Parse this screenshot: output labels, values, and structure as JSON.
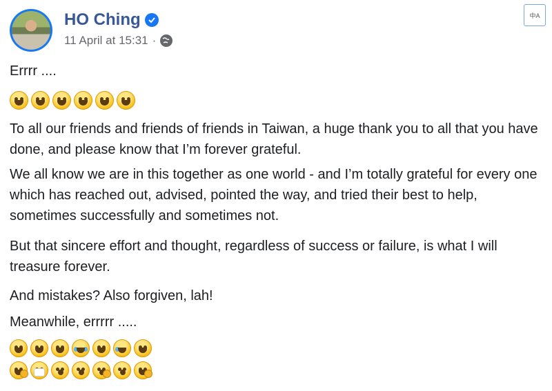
{
  "header": {
    "name": "HO Ching",
    "verified": true,
    "timestamp": "11 April at 15:31",
    "separator": "·",
    "privacy_icon": "globe-icon"
  },
  "translate_button": {
    "icon": "translate-icon",
    "text": "中A"
  },
  "post": {
    "line1": "Errrr ....",
    "emoji_row1": [
      "grinning-sweat",
      "grinning-sweat",
      "grinning",
      "grinning",
      "grinning-sweat",
      "grinning-sweat"
    ],
    "para1": "To all our friends and friends of friends in Taiwan, a huge thank you to all that you have done, and please know that I’m forever grateful.",
    "para2": "We all know we are in this together as one world - and I’m totally grateful for every one which has reached out, advised, pointed the way, and tried their best to help, sometimes successfully and sometimes not.",
    "para3": "But that sincere effort and thought, regardless of success or failure, is what I will treasure forever.",
    "para4": "And mistakes? Also forgiven, lah!",
    "para5": "Meanwhile, errrrr .....",
    "emoji_row2": [
      "smiling-halo",
      "upside-down",
      "smirk",
      "tears-of-joy",
      "zany",
      "rolling-laughing",
      "smiling-halo"
    ],
    "emoji_row3": [
      "face-with-hand",
      "mask",
      "open-mouth",
      "screaming",
      "thinking",
      "flushed",
      "face-with-hand"
    ]
  },
  "colors": {
    "name": "#385898",
    "verified": "#1877f2",
    "meta": "#65676b",
    "text": "#1c1e21"
  }
}
